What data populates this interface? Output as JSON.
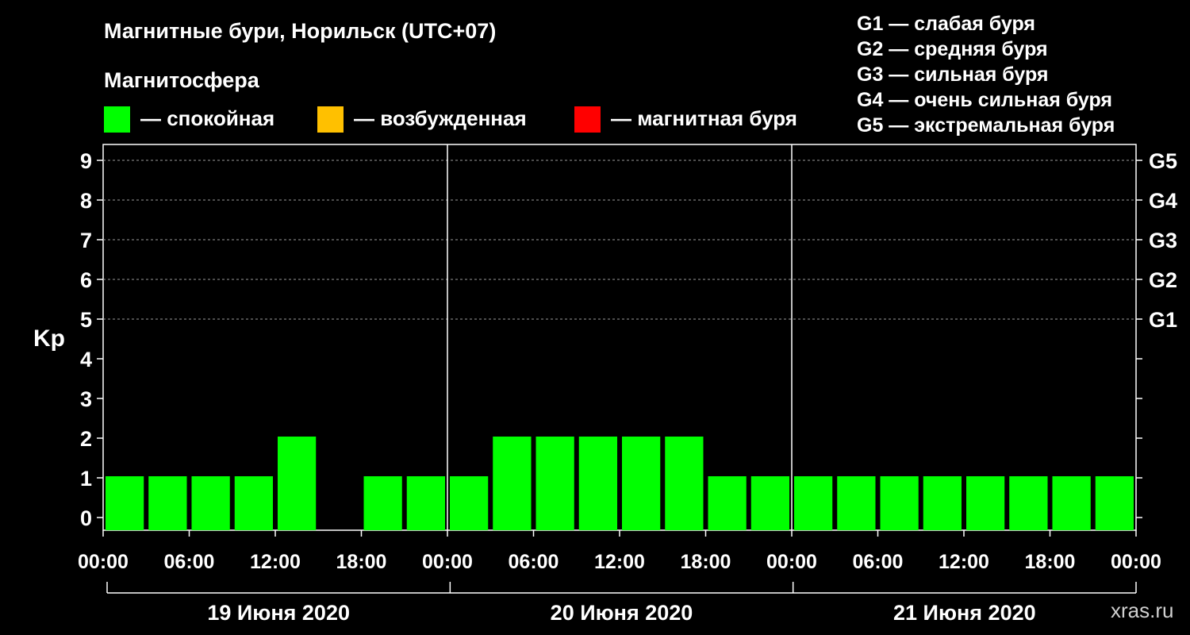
{
  "chart_data": {
    "type": "bar",
    "title": "Магнитные бури, Норильск (UTC+07)",
    "subtitle": "Магнитосфера",
    "ylabel": "Kp",
    "ylim": [
      0,
      9
    ],
    "yticks": [
      0,
      1,
      2,
      3,
      4,
      5,
      6,
      7,
      8,
      9
    ],
    "right_ticks": [
      {
        "kp": 5,
        "label": "G1"
      },
      {
        "kp": 6,
        "label": "G2"
      },
      {
        "kp": 7,
        "label": "G3"
      },
      {
        "kp": 8,
        "label": "G4"
      },
      {
        "kp": 9,
        "label": "G5"
      }
    ],
    "x_tick_labels": [
      "00:00",
      "06:00",
      "12:00",
      "18:00",
      "00:00",
      "06:00",
      "12:00",
      "18:00",
      "00:00",
      "06:00",
      "12:00",
      "18:00",
      "00:00"
    ],
    "days": [
      "19 Июня 2020",
      "20 Июня 2020",
      "21 Июня 2020"
    ],
    "interval_hours": 3,
    "kp_values": [
      1,
      1,
      1,
      1,
      2,
      null,
      1,
      1,
      1,
      2,
      2,
      2,
      2,
      2,
      1,
      1,
      1,
      1,
      1,
      1,
      1,
      1,
      1,
      1
    ],
    "grid": true,
    "legend": [
      {
        "label": "— спокойная",
        "color": "#00ff00"
      },
      {
        "label": "— возбужденная",
        "color": "#ffc000"
      },
      {
        "label": "— магнитная буря",
        "color": "#ff0000"
      }
    ],
    "storm_scale": [
      "G1 — слабая буря",
      "G2 — средняя буря",
      "G3 — сильная буря",
      "G4 — очень сильная буря",
      "G5 — экстремальная буря"
    ]
  },
  "watermark": "xras.ru"
}
